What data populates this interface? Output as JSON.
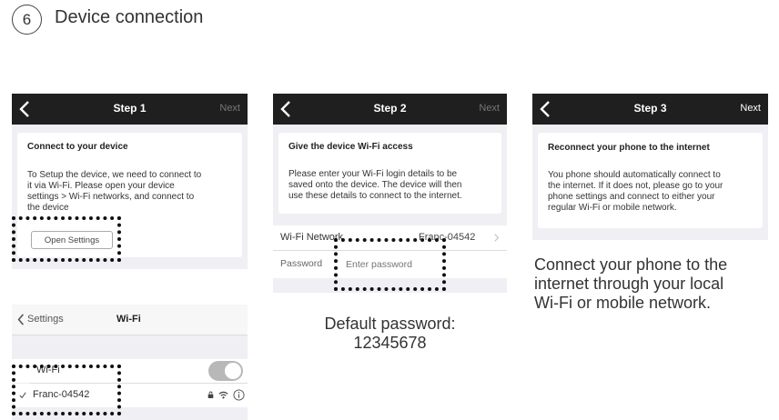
{
  "header": {
    "step_number": "6",
    "title": "Device connection"
  },
  "step1": {
    "nav": {
      "title": "Step 1",
      "next": "Next"
    },
    "card": {
      "title": "Connect to your device",
      "body_lines": [
        "To Setup the device, we need to connect to",
        "it via Wi-Fi. Please open your device",
        "settings > Wi-Fi networks, and connect to",
        "the device"
      ],
      "button": "Open Settings"
    }
  },
  "wifi_screen": {
    "back_label": "Settings",
    "title": "Wi-Fi",
    "wifi_label": "Wi-Fi",
    "network_name": "Franc-04542",
    "toggle_on": false
  },
  "step2": {
    "nav": {
      "title": "Step 2",
      "next": "Next"
    },
    "card": {
      "title": "Give the device Wi-Fi access",
      "body_lines": [
        "Please enter your Wi-Fi login details to be",
        "saved onto the device. The device will then",
        "use these details to connect to the internet."
      ]
    },
    "wifi_network_label": "Wi-Fi Network",
    "wifi_network_value": "Franc-04542",
    "password_label": "Password",
    "password_placeholder": "Enter password",
    "caption_lines": [
      "Default password:",
      "12345678"
    ]
  },
  "step3": {
    "nav": {
      "title": "Step 3",
      "next": "Next"
    },
    "card": {
      "title": "Reconnect your phone to the internet",
      "body_lines": [
        "You phone should automatically connect to",
        "the internet. If it does not, please go to your",
        "phone settings and connect to either your",
        "regular Wi-Fi or mobile network."
      ]
    },
    "caption_lines": [
      "Connect your phone to the",
      "internet through your local",
      "Wi-Fi or mobile network."
    ]
  },
  "colors": {
    "navbar": "#1f1f1f",
    "screen_bg": "#efeff4",
    "text": "#333333",
    "link_blue": "#8a8a8a"
  }
}
